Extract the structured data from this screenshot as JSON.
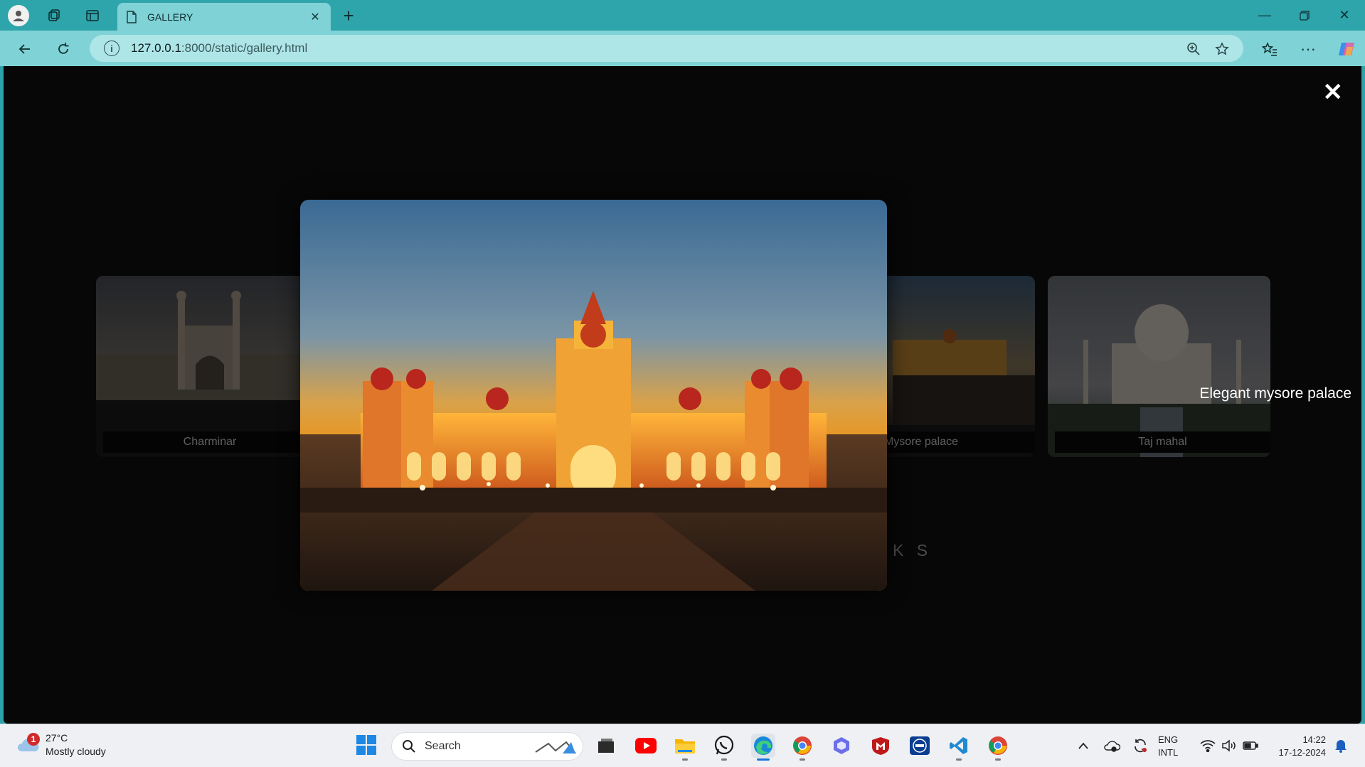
{
  "browser": {
    "tab_title": "GALLERY",
    "url_host": "127.0.0.1",
    "url_path": ":8000/static/gallery.html"
  },
  "page": {
    "cards": [
      {
        "caption": "Charminar"
      },
      {
        "caption": "Mysore palace"
      },
      {
        "caption": "Taj mahal"
      }
    ],
    "lightbox_caption": "Elegant mysore palace",
    "footer_text": "K S",
    "close_symbol": "✕"
  },
  "taskbar": {
    "weather_temp": "27°C",
    "weather_desc": "Mostly cloudy",
    "weather_badge": "1",
    "search_placeholder": "Search",
    "lang_line1": "ENG",
    "lang_line2": "INTL",
    "time": "14:22",
    "date": "17-12-2024"
  }
}
